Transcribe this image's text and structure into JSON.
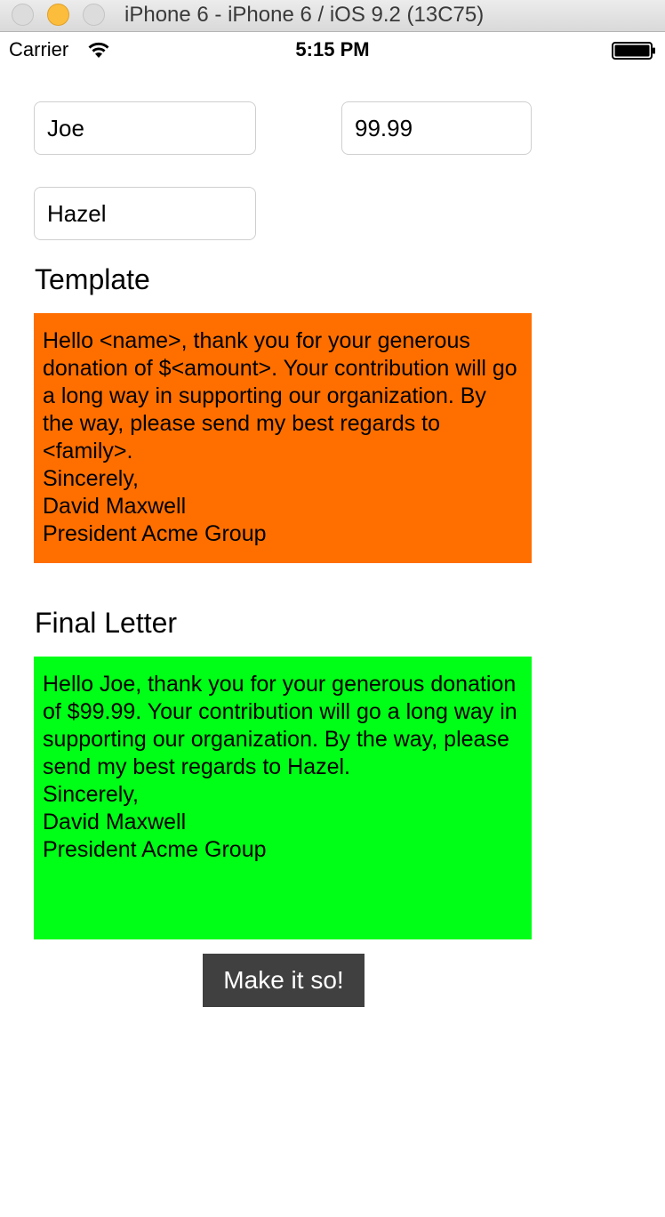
{
  "window": {
    "title": "iPhone 6 - iPhone 6 / iOS 9.2 (13C75)"
  },
  "status_bar": {
    "carrier": "Carrier",
    "time": "5:15 PM",
    "icons": [
      "wifi-icon",
      "battery-icon"
    ]
  },
  "form": {
    "name_value": "Joe",
    "amount_value": "99.99",
    "family_value": "Hazel"
  },
  "template": {
    "label": "Template",
    "text": "Hello <name>, thank you for your generous donation of $<amount>. Your contribution will go a long way in supporting our organization. By the way, please send my best regards to <family>.\nSincerely,\nDavid Maxwell\nPresident Acme Group",
    "background_color": "#ff6f00"
  },
  "final_letter": {
    "label": "Final Letter",
    "text": "Hello Joe, thank you for your generous donation of $99.99. Your contribution will go a long way in supporting our organization. By the way, please send my best regards to Hazel.\nSincerely,\nDavid Maxwell\nPresident Acme Group",
    "background_color": "#00ff16"
  },
  "action": {
    "button_label": "Make it so!"
  }
}
